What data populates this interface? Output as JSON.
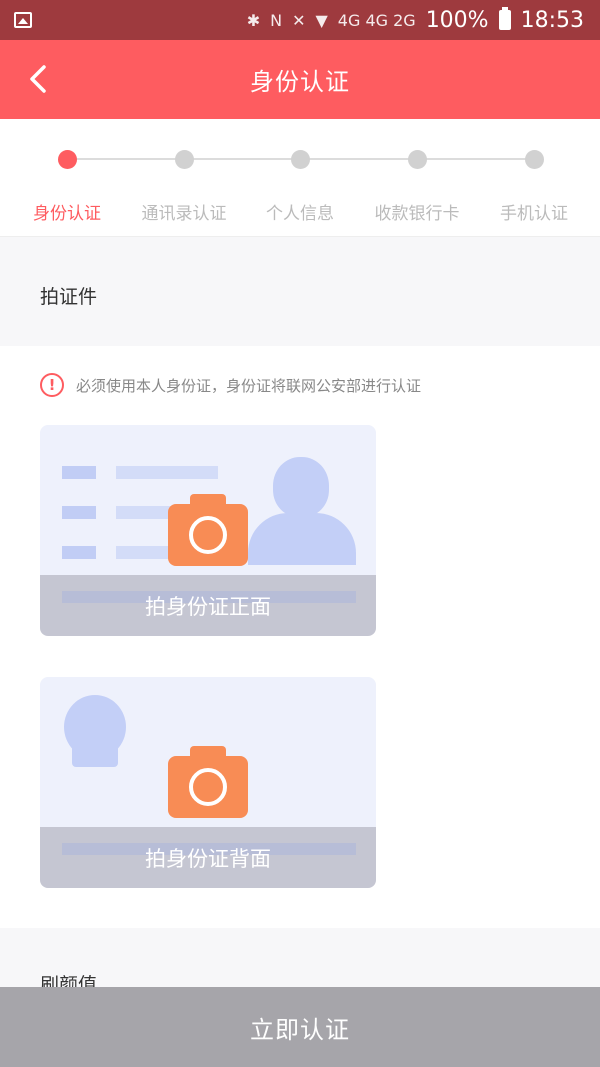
{
  "status_bar": {
    "network": "4G 4G 2G",
    "battery": "100%",
    "time": "18:53"
  },
  "header": {
    "title": "身份认证"
  },
  "steps": [
    {
      "label": "身份认证",
      "active": true
    },
    {
      "label": "通讯录认证",
      "active": false
    },
    {
      "label": "个人信息",
      "active": false
    },
    {
      "label": "收款银行卡",
      "active": false
    },
    {
      "label": "手机认证",
      "active": false
    }
  ],
  "section_id": {
    "title": "拍证件",
    "notice": "必须使用本人身份证，身份证将联网公安部进行认证",
    "front_label": "拍身份证正面",
    "back_label": "拍身份证背面"
  },
  "section_face": {
    "title": "刷颜值"
  },
  "submit_button": "立即认证",
  "colors": {
    "accent": "#fe5c60",
    "camera": "#f88c55",
    "card_bg": "#eef1fc",
    "button_disabled": "#a6a5aa"
  }
}
